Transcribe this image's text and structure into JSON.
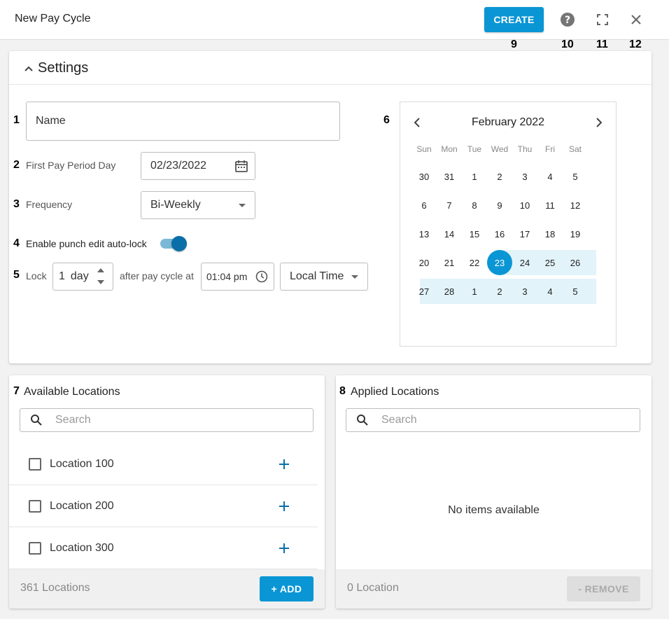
{
  "header": {
    "title": "New Pay Cycle",
    "create_label": "CREATE",
    "icons": [
      "help-icon",
      "fullscreen-icon",
      "close-icon"
    ],
    "markers": [
      "9",
      "10",
      "11",
      "12"
    ]
  },
  "settings": {
    "title": "Settings",
    "name_placeholder": "Name",
    "first_pay_label": "First Pay Period Day",
    "first_pay_value": "02/23/2022",
    "frequency_label": "Frequency",
    "frequency_value": "Bi-Weekly",
    "autolock_label": "Enable punch edit auto-lock",
    "autolock_on": true,
    "lock_label": "Lock",
    "lock_amount": "1",
    "lock_unit": "day",
    "after_label": "after pay cycle at",
    "lock_time": "01:04 pm",
    "timezone_value": "Local Time",
    "markers": [
      "1",
      "2",
      "3",
      "4",
      "5",
      "6"
    ]
  },
  "calendar": {
    "month_label": "February 2022",
    "weekdays": [
      "Sun",
      "Mon",
      "Tue",
      "Wed",
      "Thu",
      "Fri",
      "Sat"
    ],
    "weeks": [
      [
        "30",
        "31",
        "1",
        "2",
        "3",
        "4",
        "5"
      ],
      [
        "6",
        "7",
        "8",
        "9",
        "10",
        "11",
        "12"
      ],
      [
        "13",
        "14",
        "15",
        "16",
        "17",
        "18",
        "19"
      ],
      [
        "20",
        "21",
        "22",
        "23",
        "24",
        "25",
        "26"
      ],
      [
        "27",
        "28",
        "1",
        "2",
        "3",
        "4",
        "5"
      ]
    ],
    "selected": "23"
  },
  "available": {
    "marker": "7",
    "title": "Available Locations",
    "search_placeholder": "Search",
    "items": [
      {
        "label": "Location 100"
      },
      {
        "label": "Location 200"
      },
      {
        "label": "Location 300"
      }
    ],
    "count_label": "361 Locations",
    "add_label": "+ ADD"
  },
  "applied": {
    "marker": "8",
    "title": "Applied Locations",
    "search_placeholder": "Search",
    "empty_label": "No items available",
    "count_label": "0 Location",
    "remove_label": "- REMOVE"
  },
  "colors": {
    "accent": "#0a96d4",
    "range_highlight": "#e2f3fa",
    "toggle_knob": "#0a6fa8"
  }
}
